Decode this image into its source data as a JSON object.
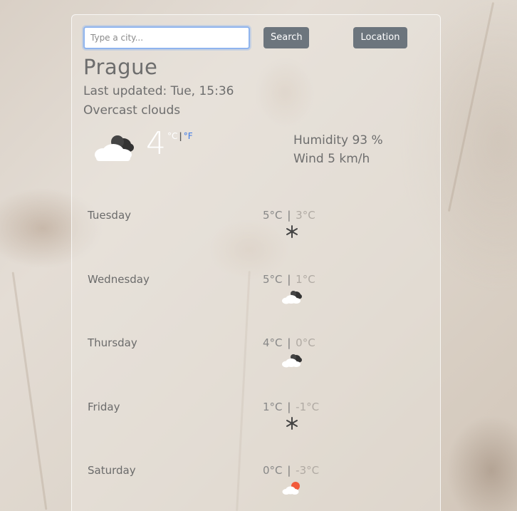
{
  "search": {
    "placeholder": "Type a city...",
    "button_label": "Search"
  },
  "location_button_label": "Location",
  "current": {
    "city": "Prague",
    "last_updated": "Last updated: Tue, 15:36",
    "description": "Overcast clouds",
    "temperature": "4",
    "unit_c": "°C",
    "unit_sep": "|",
    "unit_f": "°F",
    "humidity": "Humidity 93 %",
    "wind": "Wind 5 km/h",
    "icon": "cloud-icon"
  },
  "forecast": [
    {
      "day": "Tuesday",
      "max": "5°C",
      "min": "3°C",
      "icon": "snow-icon"
    },
    {
      "day": "Wednesday",
      "max": "5°C",
      "min": "1°C",
      "icon": "cloud-icon"
    },
    {
      "day": "Thursday",
      "max": "4°C",
      "min": "0°C",
      "icon": "cloud-icon"
    },
    {
      "day": "Friday",
      "max": "1°C",
      "min": "-1°C",
      "icon": "snow-icon"
    },
    {
      "day": "Saturday",
      "max": "0°C",
      "min": "-3°C",
      "icon": "sun-cloud-icon"
    }
  ],
  "range_sep": "|",
  "colors": {
    "button": "#6c757d",
    "fahrenheit_link": "#3b78e7",
    "input_focus": "#8fb4ee"
  }
}
